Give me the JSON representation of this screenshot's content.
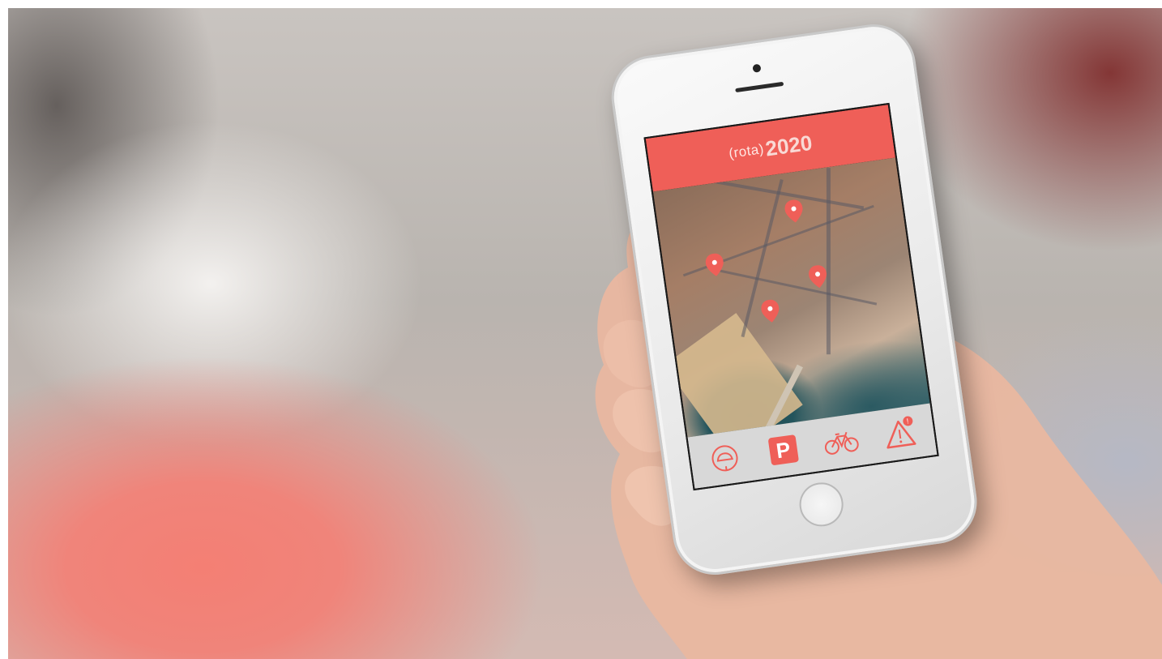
{
  "app": {
    "logo_paren": "(rota)",
    "logo_year": "2020"
  },
  "map": {
    "pins": 4
  },
  "toolbar": {
    "items": [
      {
        "icon": "electric-car-icon"
      },
      {
        "icon": "parking-icon",
        "label": "P"
      },
      {
        "icon": "bicycle-icon"
      },
      {
        "icon": "alert-icon",
        "badge": "!"
      }
    ]
  },
  "colors": {
    "accent": "#ef5f58",
    "toolbar": "#d8d8d8"
  }
}
